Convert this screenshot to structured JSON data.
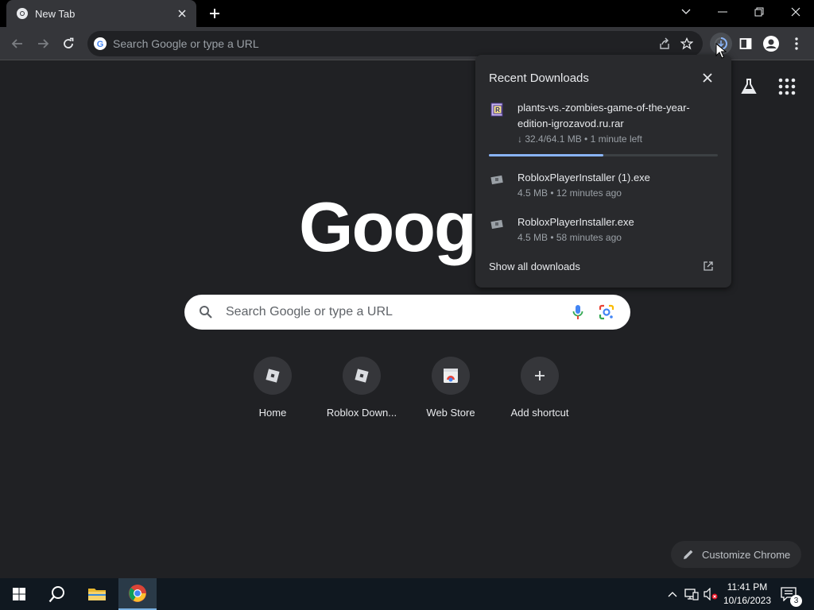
{
  "tab": {
    "title": "New Tab"
  },
  "omnibox": {
    "placeholder": "Search Google or type a URL"
  },
  "logo": {
    "text": "Google"
  },
  "search": {
    "placeholder": "Search Google or type a URL"
  },
  "shortcuts": [
    {
      "label": "Home"
    },
    {
      "label": "Roblox Down..."
    },
    {
      "label": "Web Store"
    },
    {
      "label": "Add shortcut"
    }
  ],
  "customize": {
    "label": "Customize Chrome"
  },
  "downloads": {
    "title": "Recent Downloads",
    "items": [
      {
        "name": "plants-vs.-zombies-game-of-the-year-edition-igrozavod.ru.rar",
        "meta": "↓ 32.4/64.1 MB • 1 minute left",
        "progress": 0.5
      },
      {
        "name": "RobloxPlayerInstaller (1).exe",
        "meta": "4.5 MB • 12 minutes ago"
      },
      {
        "name": "RobloxPlayerInstaller.exe",
        "meta": "4.5 MB • 58 minutes ago"
      }
    ],
    "show_all": "Show all downloads"
  },
  "taskbar": {
    "time": "11:41 PM",
    "date": "10/16/2023",
    "notifications": "3"
  },
  "colors": {
    "accent": "#8ab4f8",
    "background": "#202124",
    "toolbar": "#35363a"
  }
}
